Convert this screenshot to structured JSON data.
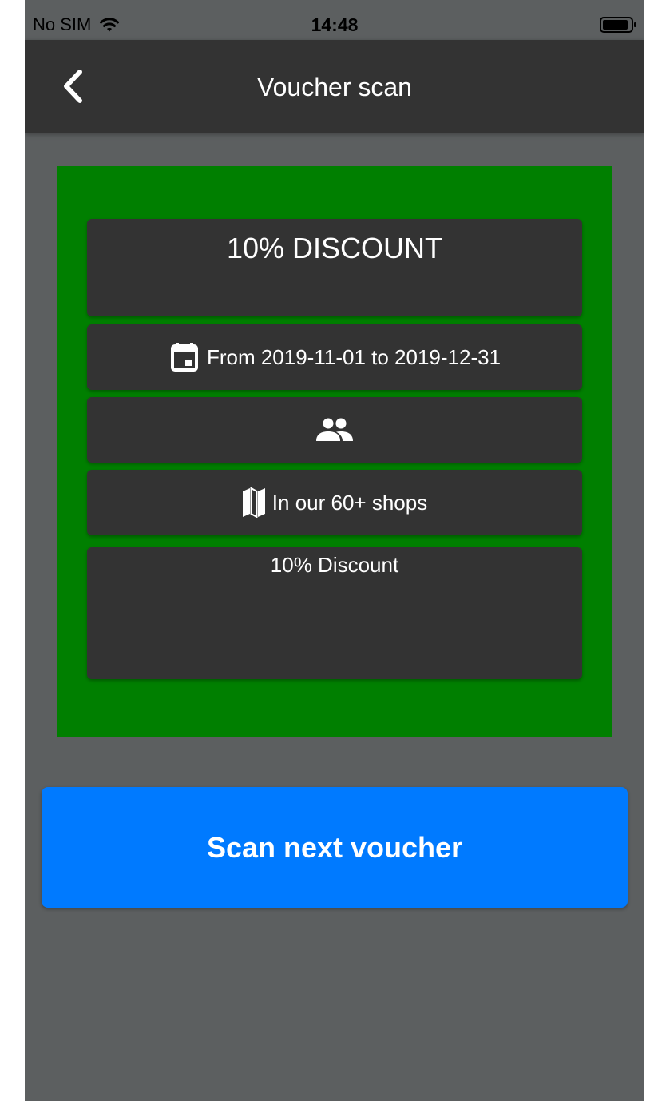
{
  "status_bar": {
    "carrier": "No SIM",
    "time": "14:48",
    "wifi_icon": "wifi-icon",
    "battery_icon": "battery-icon"
  },
  "nav": {
    "back_icon": "chevron-left-icon",
    "title": "Voucher scan"
  },
  "voucher": {
    "background_color": "#007f00",
    "title": "10% DISCOUNT",
    "validity_icon": "calendar-icon",
    "validity": "From 2019-11-01 to 2019-12-31",
    "audience_icon": "people-icon",
    "location_icon": "map-icon",
    "location": "In our 60+ shops",
    "description": "10% Discount"
  },
  "actions": {
    "scan_next_label": "Scan next voucher",
    "button_color": "#007aff"
  }
}
